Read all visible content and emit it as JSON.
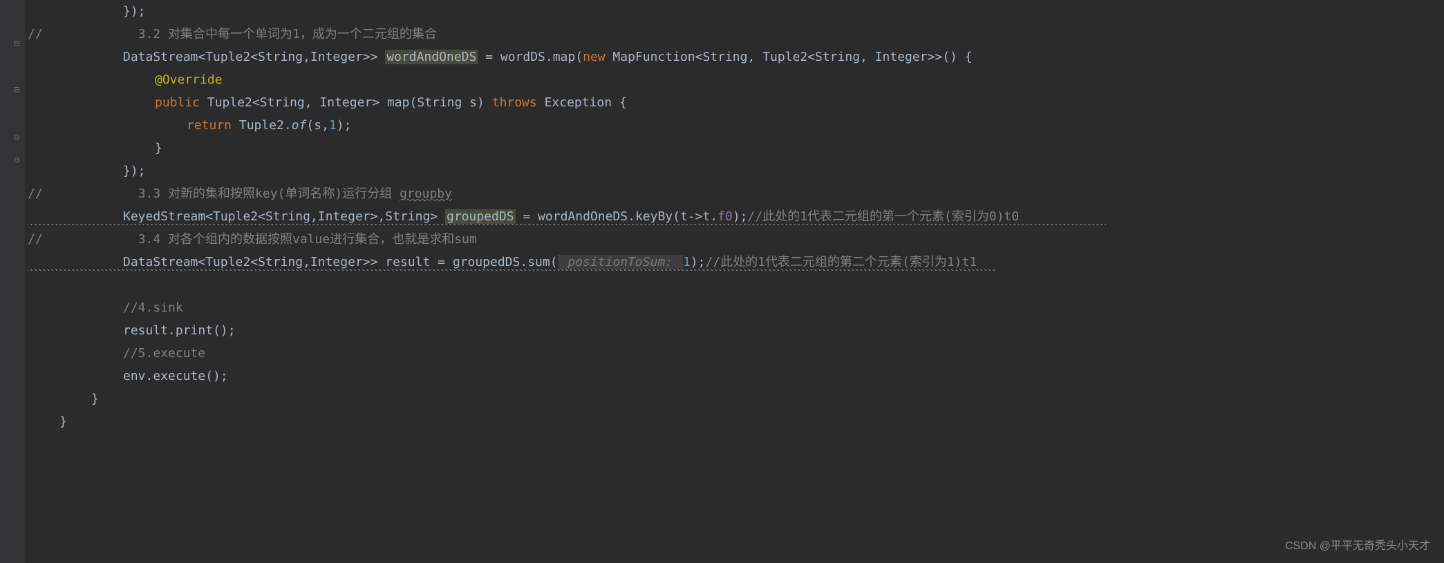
{
  "lines": {
    "l1_closing": "});",
    "l2_marker": "//",
    "l2_comment": "3.2 对集合中每一个单词为1，成为一个二元组的集合",
    "l3_decl_part1": "DataStream<Tuple2<String,Integer>> ",
    "l3_var": "wordAndOneDS",
    "l3_part2": " = wordDS.map(",
    "l3_new": "new",
    "l3_part3": " MapFunction<String, Tuple2<String, Integer>>() {",
    "l4_annotation": "@Override",
    "l5_public": "public",
    "l5_sig1": " Tuple2<String, Integer> ",
    "l5_method": "map",
    "l5_sig2": "(String s) ",
    "l5_throws": "throws",
    "l5_exception": " Exception {",
    "l6_return": "return",
    "l6_tuple": " Tuple2.",
    "l6_of": "of",
    "l6_args": "(s,",
    "l6_num": "1",
    "l6_end": ");",
    "l7_brace": "}",
    "l8_closing": "});",
    "l9_marker": "//",
    "l9_comment_a": "3.3 对新的集和按照key(单词名称)运行分组 ",
    "l9_groupby": "groupby",
    "l10_decl": "KeyedStream<Tuple2<String,Integer>,String> ",
    "l10_var": "groupedDS",
    "l10_part2": " = wordAndOneDS.keyBy(t->t.",
    "l10_field": "f0",
    "l10_end": ");",
    "l10_comment": "//此处的1代表二元组的第一个元素(索引为0)t0",
    "l11_marker": "//",
    "l11_comment": "3.4 对各个组内的数据按照value进行集合，也就是求和sum",
    "l12_decl": "DataStream<Tuple2<String,Integer>> result = groupedDS.sum(",
    "l12_hint": " positionToSum: ",
    "l12_num": "1",
    "l12_end": ");",
    "l12_comment": "//此处的1代表二元组的第二个元素(索引为1)t1",
    "l13_empty": "",
    "l14_comment": "//4.sink",
    "l15_code": "result.print();",
    "l16_comment": "//5.execute",
    "l17_code": "env.execute();",
    "l18_brace": "}",
    "l19_brace": "}"
  },
  "watermark": "CSDN @平平无奇秃头小天才"
}
